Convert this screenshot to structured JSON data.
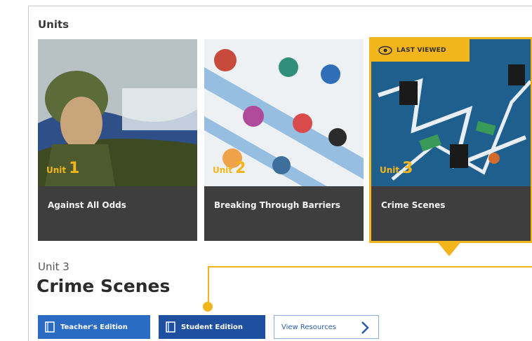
{
  "section": {
    "title": "Units"
  },
  "cards": [
    {
      "unit_word": "Unit",
      "unit_number": "1",
      "title": "Against All Odds"
    },
    {
      "unit_word": "Unit",
      "unit_number": "2",
      "title": "Breaking Through Barriers"
    },
    {
      "unit_word": "Unit",
      "unit_number": "3",
      "title": "Crime Scenes",
      "badge": "LAST VIEWED"
    }
  ],
  "selected": {
    "unit_label": "Unit 3",
    "unit_name": "Crime Scenes"
  },
  "buttons": {
    "teacher": "Teacher's Edition",
    "student": "Student Edition",
    "resources": "View Resources"
  },
  "colors": {
    "accent": "#f3b51c",
    "primary": "#2a6cc4",
    "primary_dark": "#1f4f9f",
    "card_bg": "#3e3e3e"
  }
}
